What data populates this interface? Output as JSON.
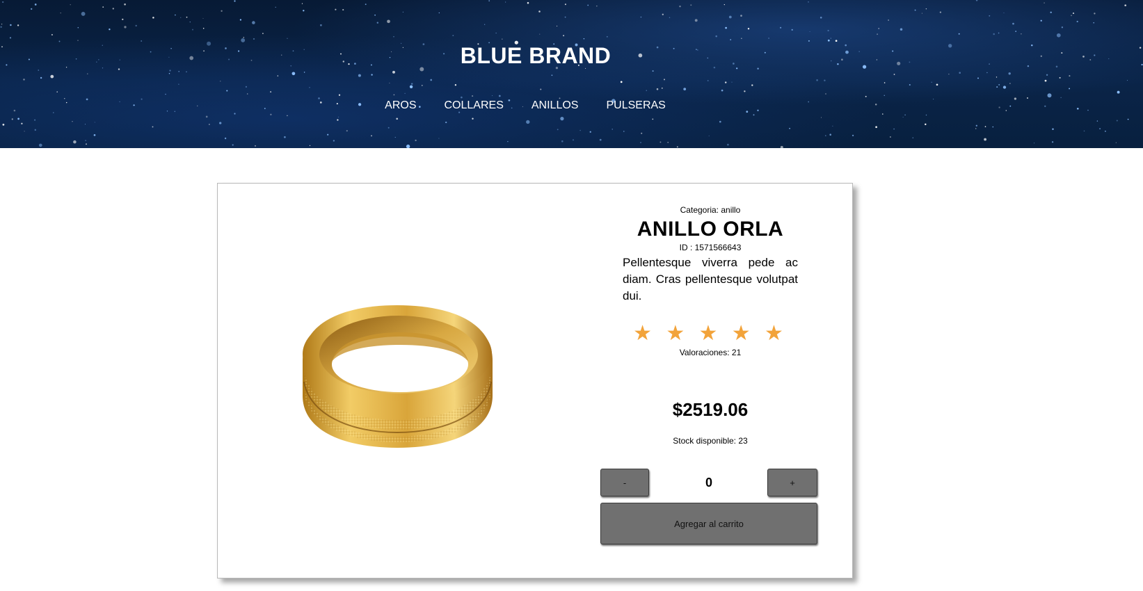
{
  "header": {
    "brand": "BLUE BRAND",
    "nav": [
      "AROS",
      "COLLARES",
      "ANILLOS",
      "PULSERAS"
    ]
  },
  "product": {
    "category": "Categoria: anillo",
    "title": "ANILLO ORLA",
    "id_text": "ID : 1571566643",
    "description": "Pellentesque viverra pede ac diam. Cras pellentesque volutpat dui.",
    "rating_stars": "★ ★ ★ ★ ★",
    "rating": 5,
    "ratings_text": "Valoraciones: 21",
    "price": "$2519.06",
    "stock": "Stock disponible: 23",
    "image_icon": "gold-ring-image"
  },
  "cart": {
    "minus_label": "-",
    "plus_label": "+",
    "quantity": "0",
    "add_label": "Agregar al carrito"
  },
  "colors": {
    "star": "#f2a33a",
    "button": "#707070",
    "header_bg": "#0a2448"
  }
}
